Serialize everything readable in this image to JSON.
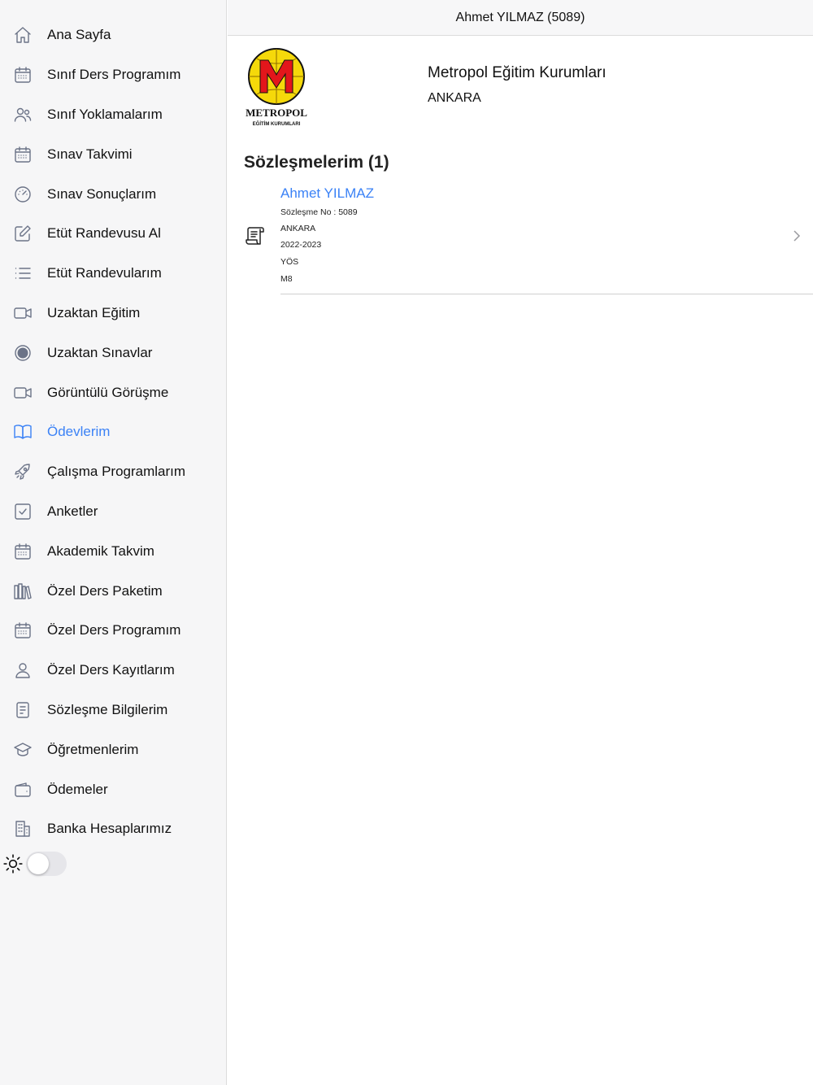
{
  "header": {
    "title": "Ahmet YILMAZ (5089)"
  },
  "sidebar": {
    "items": [
      {
        "label": "Ana Sayfa",
        "icon": "home-icon"
      },
      {
        "label": "Sınıf Ders Programım",
        "icon": "calendar-icon"
      },
      {
        "label": "Sınıf Yoklamalarım",
        "icon": "users-icon"
      },
      {
        "label": "Sınav Takvimi",
        "icon": "calendar-icon"
      },
      {
        "label": "Sınav Sonuçlarım",
        "icon": "gauge-icon"
      },
      {
        "label": "Etüt Randevusu Al",
        "icon": "edit-icon"
      },
      {
        "label": "Etüt Randevularım",
        "icon": "list-icon"
      },
      {
        "label": "Uzaktan Eğitim",
        "icon": "video-icon"
      },
      {
        "label": "Uzaktan Sınavlar",
        "icon": "record-icon"
      },
      {
        "label": "Görüntülü Görüşme",
        "icon": "video-icon"
      },
      {
        "label": "Ödevlerim",
        "icon": "book-open-icon",
        "active": true
      },
      {
        "label": "Çalışma Programlarım",
        "icon": "rocket-icon"
      },
      {
        "label": "Anketler",
        "icon": "check-square-icon"
      },
      {
        "label": "Akademik Takvim",
        "icon": "calendar-icon"
      },
      {
        "label": "Özel Ders Paketim",
        "icon": "books-icon"
      },
      {
        "label": "Özel Ders Programım",
        "icon": "calendar-icon"
      },
      {
        "label": "Özel Ders Kayıtlarım",
        "icon": "user-icon"
      },
      {
        "label": "Sözleşme Bilgilerim",
        "icon": "document-icon"
      },
      {
        "label": "Öğretmenlerim",
        "icon": "graduation-cap-icon"
      },
      {
        "label": "Ödemeler",
        "icon": "wallet-icon"
      },
      {
        "label": "Banka Hesaplarımız",
        "icon": "building-icon"
      }
    ],
    "theme_toggle": {
      "icon": "sun-icon",
      "on": false
    }
  },
  "school": {
    "logo_text": "METROPOL",
    "logo_subtext": "EĞİTİM KURUMLARI",
    "logo_letter": "M",
    "name": "Metropol Eğitim Kurumları",
    "city": "ANKARA"
  },
  "contracts": {
    "title": "Sözleşmelerim (1)",
    "items": [
      {
        "name": "Ahmet YILMAZ",
        "lines": [
          "Sözleşme No : 5089",
          "ANKARA",
          "2022-2023",
          "YÖS",
          "M8"
        ],
        "icon": "receipt-icon"
      }
    ]
  },
  "colors": {
    "accent": "#3b82f6",
    "icon_gray": "#6b7387",
    "logo_yellow": "#f5d90a",
    "logo_red": "#e3161b"
  }
}
